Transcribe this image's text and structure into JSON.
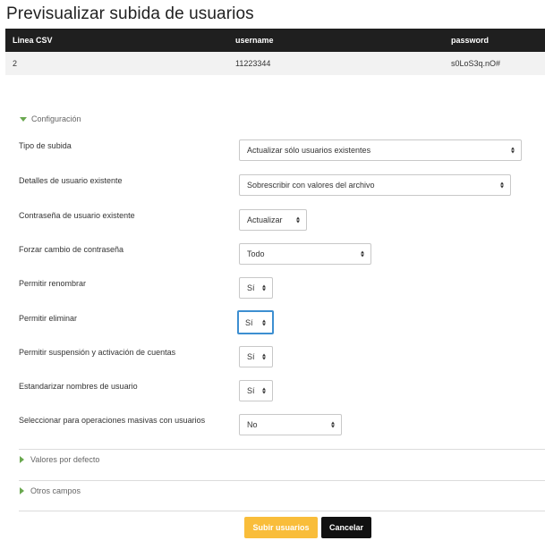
{
  "page": {
    "title": "Previsualizar subida de usuarios"
  },
  "table": {
    "headers": [
      "Linea CSV",
      "username",
      "password"
    ],
    "rows": [
      [
        "2",
        "11223344",
        "s0LoS3q.nO#"
      ]
    ]
  },
  "sections": {
    "config": "Configuración",
    "defaults": "Valores por defecto",
    "other": "Otros campos"
  },
  "fields": [
    {
      "label": "Tipo de subida",
      "value": "Actualizar sólo usuarios existentes"
    },
    {
      "label": "Detalles de usuario existente",
      "value": "Sobrescribir con valores del archivo"
    },
    {
      "label": "Contraseña de usuario existente",
      "value": "Actualizar"
    },
    {
      "label": "Forzar cambio de contraseña",
      "value": "Todo"
    },
    {
      "label": "Permitir renombrar",
      "value": "Sí"
    },
    {
      "label": "Permitir eliminar",
      "value": "Sí"
    },
    {
      "label": "Permitir suspensión y activación de cuentas",
      "value": "Sí"
    },
    {
      "label": "Estandarizar nombres de usuario",
      "value": "Sí"
    },
    {
      "label": "Seleccionar para operaciones masivas con usuarios",
      "value": "No"
    }
  ],
  "buttons": {
    "submit": "Subir usuarios",
    "cancel": "Cancelar"
  },
  "colors": {
    "accent": "#f9bd3a",
    "focus": "#3d8fd1",
    "header_bg": "#1f1f1f",
    "expander": "#6aa84f"
  }
}
